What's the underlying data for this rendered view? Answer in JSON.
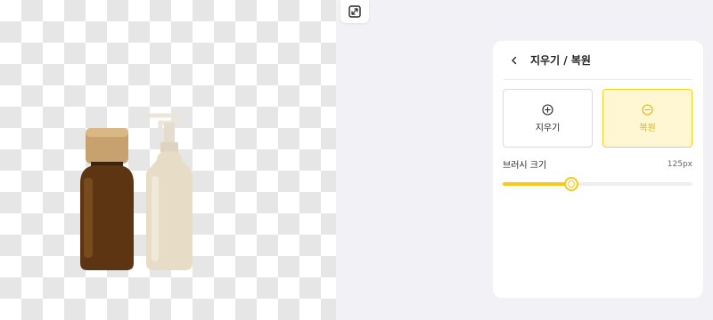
{
  "toolbar": {
    "expand_icon": "expand-diagonal-icon"
  },
  "panel": {
    "back_icon": "chevron-left-icon",
    "title": "지우기 / 복원",
    "modes": [
      {
        "label": "지우기",
        "icon": "plus-circle-icon",
        "active": false
      },
      {
        "label": "복원",
        "icon": "minus-circle-icon",
        "active": true
      }
    ],
    "brush": {
      "label": "브러시 크기",
      "value_text": "125px",
      "level": 0.36
    }
  },
  "colors": {
    "accent": "#f6c91a",
    "accent_bg": "#fff7d3",
    "panel_bg": "#ffffff",
    "page_bg": "#f1f1f6"
  }
}
